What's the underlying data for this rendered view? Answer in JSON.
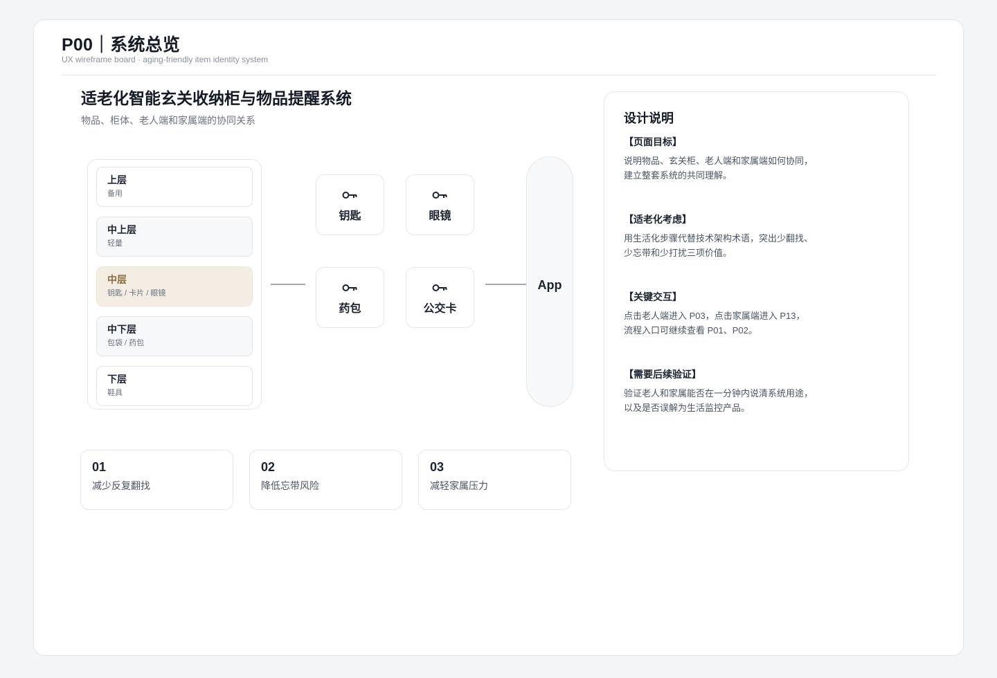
{
  "header": {
    "title": "P00｜系统总览",
    "subtitle": "UX wireframe board · aging-friendly item identity system"
  },
  "hero": {
    "title": "适老化智能玄关收纳柜与物品提醒系统",
    "subtitle": "物品、柜体、老人端和家属端的协同关系"
  },
  "cabinet": {
    "shelves": [
      {
        "name": "上层",
        "desc": "备用",
        "state": "default"
      },
      {
        "name": "中上层",
        "desc": "轻量",
        "state": "light"
      },
      {
        "name": "中层",
        "desc": "钥匙 / 卡片 / 眼镜",
        "state": "active"
      },
      {
        "name": "中下层",
        "desc": "包袋 / 药包",
        "state": "light"
      },
      {
        "name": "下层",
        "desc": "鞋具",
        "state": "default"
      }
    ]
  },
  "items": [
    {
      "label": "钥匙",
      "icon": "key-icon"
    },
    {
      "label": "眼镜",
      "icon": "key-icon"
    },
    {
      "label": "药包",
      "icon": "key-icon"
    },
    {
      "label": "公交卡",
      "icon": "key-icon"
    }
  ],
  "app": {
    "label": "App"
  },
  "values": [
    {
      "num": "01",
      "text": "减少反复翻找"
    },
    {
      "num": "02",
      "text": "降低忘带风险"
    },
    {
      "num": "03",
      "text": "减轻家属压力"
    }
  ],
  "notes": {
    "title": "设计说明",
    "sections": [
      {
        "heading": "【页面目标】",
        "lines": [
          "说明物品、玄关柜、老人端和家属端如何协同，",
          "建立整套系统的共同理解。"
        ]
      },
      {
        "heading": "【适老化考虑】",
        "lines": [
          "用生活化步骤代替技术架构术语，突出少翻找、",
          "少忘带和少打扰三项价值。"
        ]
      },
      {
        "heading": "【关键交互】",
        "lines": [
          "点击老人端进入 P03，点击家属端进入 P13，",
          "流程入口可继续查看 P01、P02。"
        ]
      },
      {
        "heading": "【需要后续验证】",
        "lines": [
          "验证老人和家属能否在一分钟内说清系统用途，",
          "以及是否误解为生活监控产品。"
        ]
      }
    ]
  },
  "colors": {
    "active_shelf_bg": "#f4ede3",
    "active_shelf_text": "#8a6a3e",
    "page_bg": "#f4f5f7"
  }
}
